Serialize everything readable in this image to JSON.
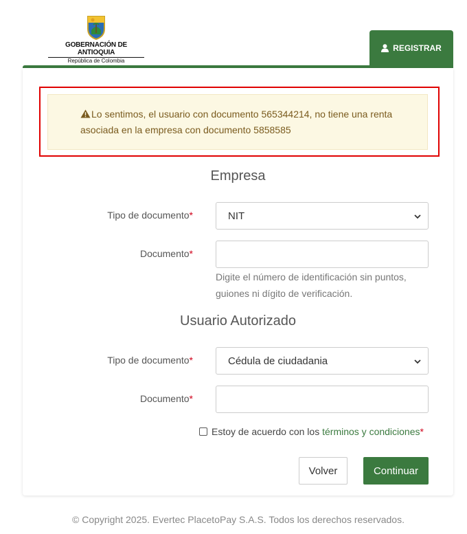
{
  "header": {
    "logo_title": "GOBERNACIÓN DE ANTIOQUIA",
    "logo_subtitle": "República de Colombia",
    "register_tab": "REGISTRAR",
    "register_icon": "user-icon",
    "brand_color": "#3b7a3f"
  },
  "alert": {
    "icon": "warning-icon",
    "message": "Lo sentimos, el usuario con documento 565344214, no tiene una renta asociada en la empresa con documento 5858585",
    "highlight_color": "#e00000"
  },
  "empresa": {
    "title": "Empresa",
    "doc_type_label": "Tipo de documento",
    "doc_type_value": "NIT",
    "doc_label": "Documento",
    "doc_value": "",
    "doc_help": "Digite el número de identificación sin puntos, guiones ni dígito de verificación."
  },
  "usuario": {
    "title": "Usuario Autorizado",
    "doc_type_label": "Tipo de documento",
    "doc_type_value": "Cédula de ciudadania",
    "doc_label": "Documento",
    "doc_value": ""
  },
  "terms": {
    "prefix": "Estoy de acuerdo con los",
    "link": "términos y condiciones",
    "checked": false
  },
  "required_mark": "*",
  "buttons": {
    "back": "Volver",
    "continue": "Continuar"
  },
  "footer": {
    "copyright": "© Copyright 2025. Evertec PlacetoPay S.A.S. Todos los derechos reservados."
  }
}
